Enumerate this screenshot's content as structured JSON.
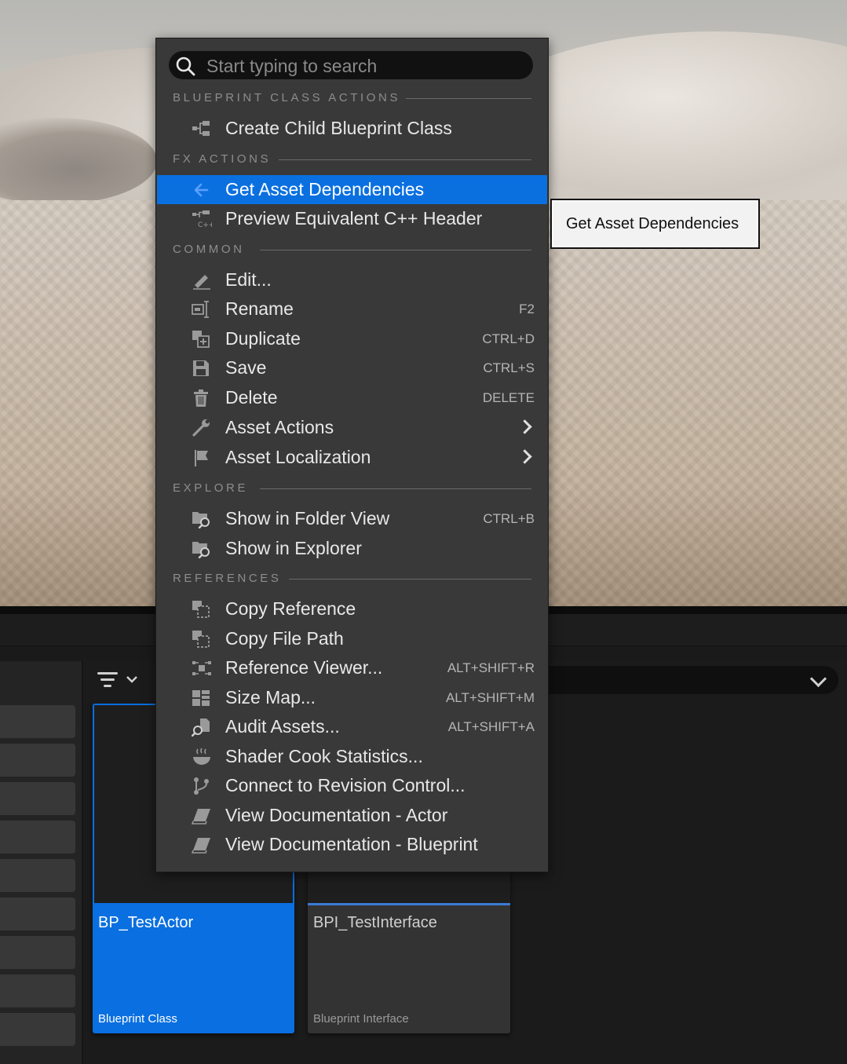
{
  "search": {
    "placeholder": "Start typing to search"
  },
  "menu": {
    "sections": {
      "blueprint_class_actions": "BLUEPRINT CLASS ACTIONS",
      "fx_actions": "FX ACTIONS",
      "common": "COMMON",
      "explore": "EXPLORE",
      "references": "REFERENCES"
    },
    "items": {
      "create_child_blueprint": {
        "label": "Create Child Blueprint Class",
        "icon": "class-hierarchy-icon"
      },
      "get_asset_dependencies": {
        "label": "Get Asset Dependencies",
        "icon": "arrow-left-icon",
        "highlighted": true
      },
      "preview_cpp_header": {
        "label": "Preview Equivalent C++ Header",
        "icon": "cpp-header-icon"
      },
      "edit": {
        "label": "Edit...",
        "icon": "pencil-icon"
      },
      "rename": {
        "label": "Rename",
        "shortcut": "F2",
        "icon": "rename-icon"
      },
      "duplicate": {
        "label": "Duplicate",
        "shortcut": "CTRL+D",
        "icon": "duplicate-icon"
      },
      "save": {
        "label": "Save",
        "shortcut": "CTRL+S",
        "icon": "save-icon"
      },
      "delete": {
        "label": "Delete",
        "shortcut": "DELETE",
        "icon": "trash-icon"
      },
      "asset_actions": {
        "label": "Asset Actions",
        "icon": "wrench-icon",
        "submenu": true
      },
      "asset_localization": {
        "label": "Asset Localization",
        "icon": "flag-icon",
        "submenu": true
      },
      "show_in_folder_view": {
        "label": "Show in Folder View",
        "shortcut": "CTRL+B",
        "icon": "folder-search-icon"
      },
      "show_in_explorer": {
        "label": "Show in Explorer",
        "icon": "folder-search-icon"
      },
      "copy_reference": {
        "label": "Copy Reference",
        "icon": "copy-reference-icon"
      },
      "copy_file_path": {
        "label": "Copy File Path",
        "icon": "copy-path-icon"
      },
      "reference_viewer": {
        "label": "Reference Viewer...",
        "shortcut": "ALT+SHIFT+R",
        "icon": "reference-viewer-icon"
      },
      "size_map": {
        "label": "Size Map...",
        "shortcut": "ALT+SHIFT+M",
        "icon": "size-map-icon"
      },
      "audit_assets": {
        "label": "Audit Assets...",
        "shortcut": "ALT+SHIFT+A",
        "icon": "audit-icon"
      },
      "shader_cook_statistics": {
        "label": "Shader Cook Statistics...",
        "icon": "steam-bowl-icon"
      },
      "connect_revision_control": {
        "label": "Connect to Revision Control...",
        "icon": "branch-icon"
      },
      "view_docs_actor": {
        "label": "View Documentation - Actor",
        "icon": "book-icon"
      },
      "view_docs_blueprint": {
        "label": "View Documentation - Blueprint",
        "icon": "book-icon"
      }
    }
  },
  "tooltip": {
    "text": "Get Asset Dependencies"
  },
  "assets": [
    {
      "name": "BP_TestActor",
      "type": "Blueprint Class",
      "selected": true
    },
    {
      "name": "BPI_TestInterface",
      "type": "Blueprint Interface",
      "selected": false
    }
  ],
  "colors": {
    "accent": "#0a70e0",
    "menu_bg": "#393939",
    "section_text": "#8d8d8d",
    "icon_gray": "#9a9a9a",
    "highlight_arrow": "#5aa0ff"
  }
}
